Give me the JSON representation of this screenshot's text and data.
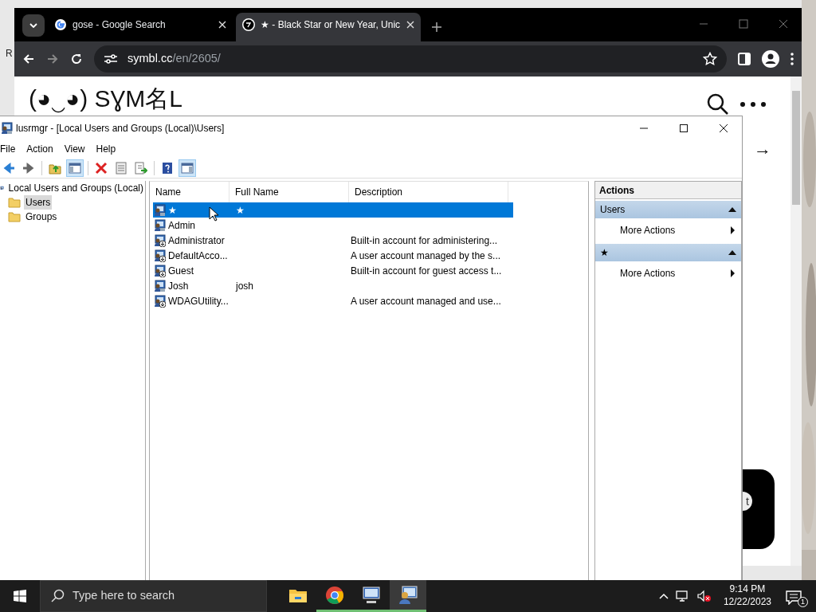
{
  "desktop": {
    "edge_text": "R"
  },
  "browser": {
    "tabs": [
      {
        "title": "gose - Google Search",
        "kind": "google",
        "selected": false
      },
      {
        "title": "★ - Black Star or New Year, Unic",
        "kind": "symbl",
        "selected": true
      }
    ],
    "address": {
      "host": "symbl.cc",
      "path": "/en/2605/"
    },
    "page": {
      "logo": "(◕‿◕) SƔM名L",
      "arrow": "→",
      "chat_text": "t"
    }
  },
  "mmc": {
    "title": "lusrmgr - [Local Users and Groups (Local)\\Users]",
    "menu": [
      "File",
      "Action",
      "View",
      "Help"
    ],
    "toolbar": [
      {
        "kind": "back",
        "pressed": false
      },
      {
        "kind": "forward",
        "pressed": false
      },
      {
        "kind": "sep"
      },
      {
        "kind": "up",
        "pressed": false
      },
      {
        "kind": "tree",
        "pressed": true
      },
      {
        "kind": "sep"
      },
      {
        "kind": "delete",
        "pressed": false
      },
      {
        "kind": "properties",
        "pressed": false
      },
      {
        "kind": "export",
        "pressed": false
      },
      {
        "kind": "sep"
      },
      {
        "kind": "help",
        "pressed": false
      },
      {
        "kind": "pane",
        "pressed": true
      }
    ],
    "tree": {
      "label": "Local Users and Groups (Local)",
      "children": [
        {
          "label": "Users",
          "selected": true
        },
        {
          "label": "Groups",
          "selected": false
        }
      ]
    },
    "columns": [
      "Name",
      "Full Name",
      "Description"
    ],
    "rows": [
      {
        "name": "★",
        "full_name": "★",
        "disabled": false,
        "selected": true
      },
      {
        "name": "Admin",
        "disabled": false,
        "selected": false
      },
      {
        "name": "Administrator",
        "description": "Built-in account for administering...",
        "disabled": true,
        "selected": false
      },
      {
        "name": "DefaultAcco...",
        "description": "A user account managed by the s...",
        "disabled": true,
        "selected": false
      },
      {
        "name": "Guest",
        "description": "Built-in account for guest access t...",
        "disabled": true,
        "selected": false
      },
      {
        "name": "Josh",
        "full_name": "josh",
        "disabled": false,
        "selected": false
      },
      {
        "name": "WDAGUtility...",
        "description": "A user account managed and use...",
        "disabled": true,
        "selected": false
      }
    ],
    "actions_title": "Actions",
    "action_groups": [
      {
        "title": "Users",
        "items": [
          "More Actions"
        ]
      },
      {
        "title": "★",
        "items": [
          "More Actions"
        ]
      }
    ]
  },
  "taskbar": {
    "search_placeholder": "Type here to search",
    "apps": [
      {
        "kind": "explorer",
        "running": false,
        "active": false
      },
      {
        "kind": "chrome",
        "running": true,
        "active": false
      },
      {
        "kind": "computer",
        "running": true,
        "active": false
      },
      {
        "kind": "users",
        "running": true,
        "active": true
      }
    ],
    "time": "9:14 PM",
    "date": "12/22/2023",
    "notifications": "1"
  }
}
